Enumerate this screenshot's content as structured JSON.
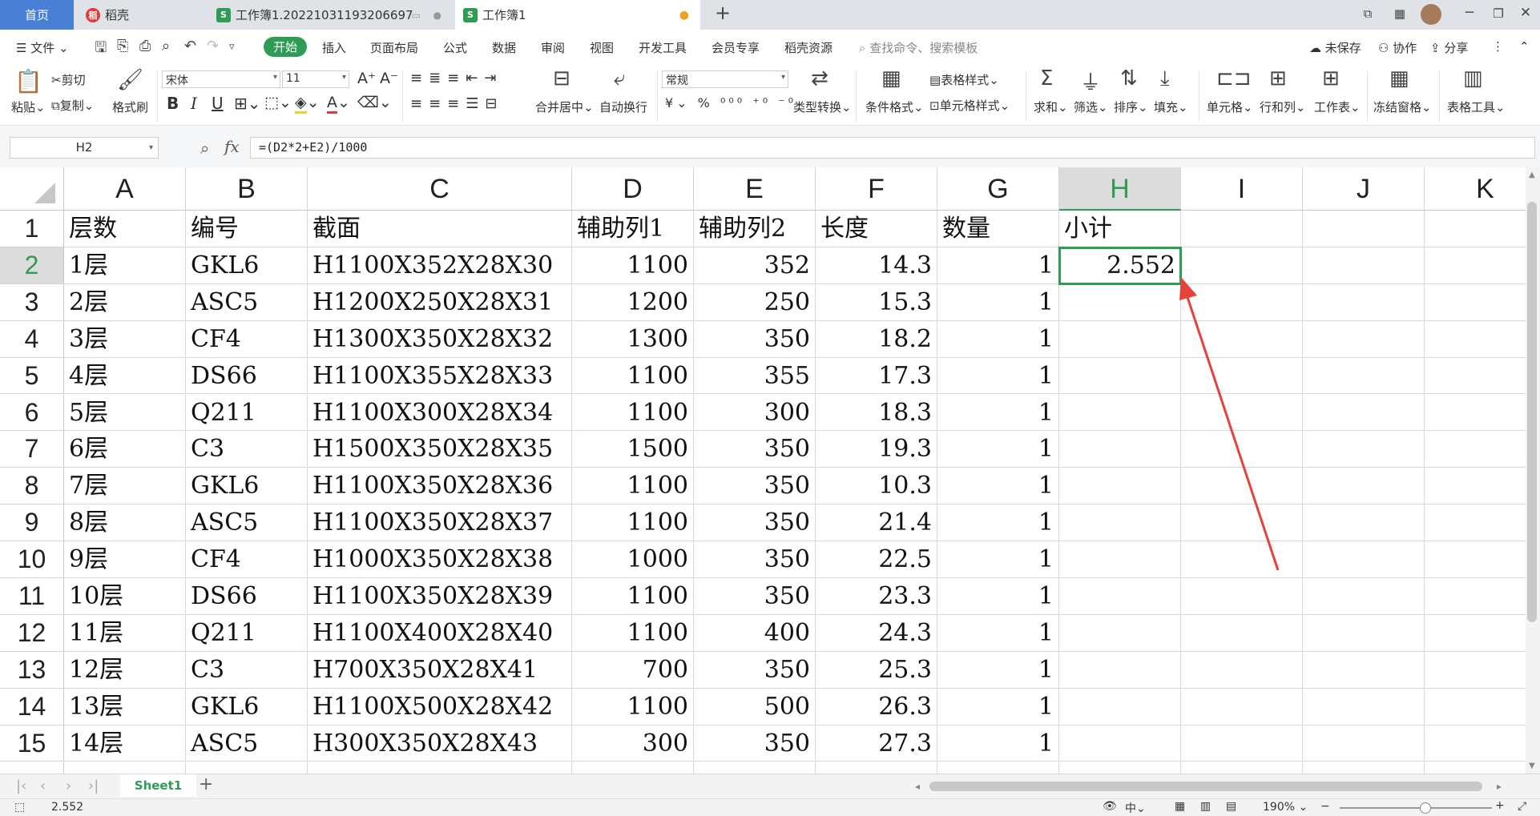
{
  "tabs": {
    "home": "首页",
    "daoke": "稻壳",
    "doc1": "工作簿1.20221031193206697",
    "doc2": "工作簿1"
  },
  "menu": {
    "file": "文件",
    "items": [
      "开始",
      "插入",
      "页面布局",
      "公式",
      "数据",
      "审阅",
      "视图",
      "开发工具",
      "会员专享",
      "稻壳资源"
    ],
    "search_placeholder": "查找命令、搜索模板",
    "unsaved": "未保存",
    "collab": "协作",
    "share": "分享"
  },
  "ribbon": {
    "paste": "粘贴",
    "cut": "剪切",
    "copy": "复制",
    "format_painter": "格式刷",
    "font_name": "宋体",
    "font_size": "11",
    "merge_center": "合并居中",
    "wrap_text": "自动换行",
    "number_format": "常规",
    "type_convert": "类型转换",
    "conditional_format": "条件格式",
    "table_style": "表格样式",
    "cell_style": "单元格样式",
    "sum": "求和",
    "filter": "筛选",
    "sort": "排序",
    "fill": "填充",
    "cells": "单元格",
    "rows_cols": "行和列",
    "worksheet": "工作表",
    "freeze": "冻结窗格",
    "table_tools": "表格工具"
  },
  "formula_bar": {
    "name_box": "H2",
    "fx": "fx",
    "formula": "=(D2*2+E2)/1000"
  },
  "columns": [
    "A",
    "B",
    "C",
    "D",
    "E",
    "F",
    "G",
    "H",
    "I",
    "J",
    "K"
  ],
  "selected_column": "H",
  "selected_row": "2",
  "rows": [
    {
      "n": "1",
      "cells": [
        "层数",
        "编号",
        "截面",
        "辅助列1",
        "辅助列2",
        "长度",
        "数量",
        "小计"
      ]
    },
    {
      "n": "2",
      "cells": [
        "1层",
        "GKL6",
        "H1100X352X28X30",
        "1100",
        "352",
        "14.3",
        "1",
        "2.552"
      ]
    },
    {
      "n": "3",
      "cells": [
        "2层",
        "ASC5",
        "H1200X250X28X31",
        "1200",
        "250",
        "15.3",
        "1",
        ""
      ]
    },
    {
      "n": "4",
      "cells": [
        "3层",
        "CF4",
        "H1300X350X28X32",
        "1300",
        "350",
        "18.2",
        "1",
        ""
      ]
    },
    {
      "n": "5",
      "cells": [
        "4层",
        "DS66",
        "H1100X355X28X33",
        "1100",
        "355",
        "17.3",
        "1",
        ""
      ]
    },
    {
      "n": "6",
      "cells": [
        "5层",
        "Q211",
        "H1100X300X28X34",
        "1100",
        "300",
        "18.3",
        "1",
        ""
      ]
    },
    {
      "n": "7",
      "cells": [
        "6层",
        "C3",
        "H1500X350X28X35",
        "1500",
        "350",
        "19.3",
        "1",
        ""
      ]
    },
    {
      "n": "8",
      "cells": [
        "7层",
        "GKL6",
        "H1100X350X28X36",
        "1100",
        "350",
        "10.3",
        "1",
        ""
      ]
    },
    {
      "n": "9",
      "cells": [
        "8层",
        "ASC5",
        "H1100X350X28X37",
        "1100",
        "350",
        "21.4",
        "1",
        ""
      ]
    },
    {
      "n": "10",
      "cells": [
        "9层",
        "CF4",
        "H1000X350X28X38",
        "1000",
        "350",
        "22.5",
        "1",
        ""
      ]
    },
    {
      "n": "11",
      "cells": [
        "10层",
        "DS66",
        "H1100X350X28X39",
        "1100",
        "350",
        "23.3",
        "1",
        ""
      ]
    },
    {
      "n": "12",
      "cells": [
        "11层",
        "Q211",
        "H1100X400X28X40",
        "1100",
        "400",
        "24.3",
        "1",
        ""
      ]
    },
    {
      "n": "13",
      "cells": [
        "12层",
        "C3",
        "H700X350X28X41",
        "700",
        "350",
        "25.3",
        "1",
        ""
      ]
    },
    {
      "n": "14",
      "cells": [
        "13层",
        "GKL6",
        "H1100X500X28X42",
        "1100",
        "500",
        "26.3",
        "1",
        ""
      ]
    },
    {
      "n": "15",
      "cells": [
        "14层",
        "ASC5",
        "H300X350X28X43",
        "300",
        "350",
        "27.3",
        "1",
        ""
      ]
    }
  ],
  "sheet_tab": "Sheet1",
  "status": {
    "value": "2.552",
    "zoom": "190%"
  },
  "colors": {
    "accent": "#2e9c55",
    "home_tab": "#4a7fd6",
    "arrow": "#e8403a"
  }
}
